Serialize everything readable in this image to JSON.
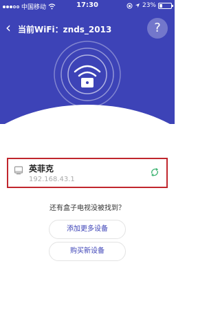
{
  "status_bar": {
    "carrier": "中国移动",
    "time": "17:30",
    "battery_percent": "23%",
    "battery_level": 0.23
  },
  "nav": {
    "back_glyph": "‹",
    "title": "当前WiFi：znds_2013",
    "help_glyph": "?"
  },
  "device": {
    "name": "英菲克",
    "ip": "192.168.43.1"
  },
  "prompt": "还有盒子电视没被找到？",
  "buttons": {
    "add_more": "添加更多设备",
    "buy_new": "购买新设备"
  },
  "colors": {
    "primary": "#3d43b7",
    "highlight_border": "#c0262d",
    "refresh_green": "#3cb371"
  },
  "icons": [
    "signal-icon",
    "wifi-status-icon",
    "location-icon",
    "battery-icon",
    "back-icon",
    "help-icon",
    "wifi-lock-icon",
    "tv-box-icon",
    "refresh-icon"
  ]
}
